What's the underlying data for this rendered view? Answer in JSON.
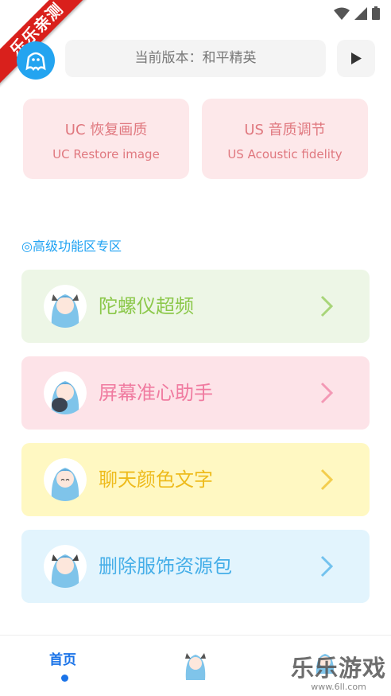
{
  "ribbon": {
    "text": "乐乐亲测"
  },
  "header": {
    "version_text": "当前版本：和平精英"
  },
  "cards": [
    {
      "title": "UC 恢复画质",
      "subtitle": "UC Restore image"
    },
    {
      "title": "US 音质调节",
      "subtitle": "US Acoustic fidelity"
    }
  ],
  "section": {
    "title": "◎高级功能区专区"
  },
  "features": [
    {
      "label": "陀螺仪超频",
      "bg": "#edf6e6",
      "color": "#8cc84b"
    },
    {
      "label": "屏幕准心助手",
      "bg": "#fde3e8",
      "color": "#f07ba0"
    },
    {
      "label": "聊天颜色文字",
      "bg": "#fff8c2",
      "color": "#eebb1c"
    },
    {
      "label": "删除服饰资源包",
      "bg": "#e2f4fd",
      "color": "#45aee8"
    }
  ],
  "nav": {
    "home_label": "首页"
  },
  "watermark": {
    "big": "乐乐游戏",
    "small": "www.6ll.com"
  },
  "colors": {
    "accent": "#1a73e8",
    "logo": "#23a4f0",
    "ribbon": "#d9201c"
  }
}
